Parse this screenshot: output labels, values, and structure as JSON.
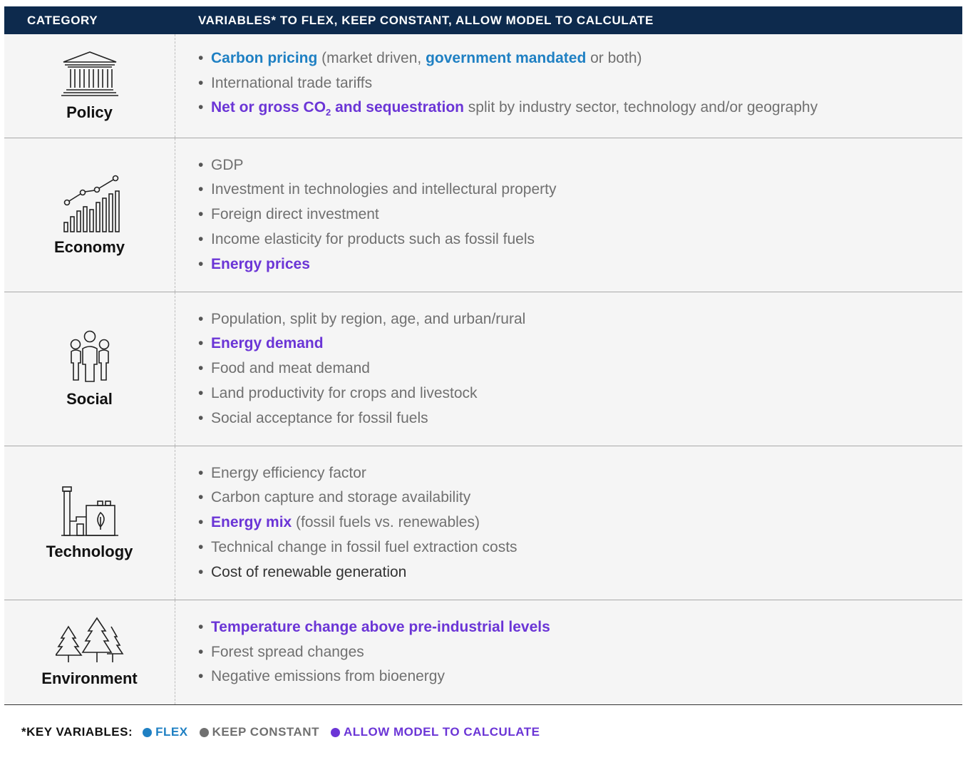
{
  "header": {
    "category": "CATEGORY",
    "variables": "VARIABLES* TO FLEX, KEEP CONSTANT, ALLOW MODEL TO CALCULATE"
  },
  "rows": {
    "policy": {
      "label": "Policy",
      "icon": "government-building-icon",
      "items": {
        "carbon_pricing": "Carbon pricing",
        "carbon_pricing_a": " (market driven, ",
        "carbon_pricing_b": "government mandated",
        "carbon_pricing_c": " or both)",
        "tariffs": "International trade tariffs",
        "net_gross_a": "Net or gross CO",
        "net_gross_sub": "2",
        "net_gross_b": " and sequestration",
        "net_gross_c": " split by industry sector, technology and/or geography"
      }
    },
    "economy": {
      "label": "Economy",
      "icon": "bar-chart-trend-icon",
      "items": {
        "gdp": "GDP",
        "investment": "Investment in technologies and intellectural property",
        "fdi": "Foreign direct investment",
        "elasticity": "Income elasticity for products such as fossil fuels",
        "energy_prices": "Energy prices"
      }
    },
    "social": {
      "label": "Social",
      "icon": "people-group-icon",
      "items": {
        "population": "Population, split by region, age, and urban/rural",
        "energy_demand": "Energy demand",
        "food": "Food and meat demand",
        "land": "Land productivity for crops and livestock",
        "acceptance": "Social acceptance for fossil fuels"
      }
    },
    "technology": {
      "label": "Technology",
      "icon": "factory-leaf-icon",
      "items": {
        "efficiency": "Energy efficiency factor",
        "ccs": "Carbon capture and storage availability",
        "mix_a": "Energy mix",
        "mix_b": " (fossil fuels vs. renewables)",
        "extraction": "Technical change in fossil fuel extraction costs",
        "renewable": "Cost of renewable generation"
      }
    },
    "environment": {
      "label": "Environment",
      "icon": "pine-trees-icon",
      "items": {
        "temperature": "Temperature change above pre-industrial levels",
        "forest": "Forest spread changes",
        "negative": "Negative emissions from bioenergy"
      }
    }
  },
  "key": {
    "title": "*KEY VARIABLES:",
    "flex": "FLEX",
    "constant": "KEEP CONSTANT",
    "calculate": "ALLOW MODEL TO CALCULATE"
  },
  "colors": {
    "header_bg": "#0d2a4d",
    "flex": "#1f80c3",
    "constant": "#707070",
    "calculate": "#6b35d6"
  }
}
